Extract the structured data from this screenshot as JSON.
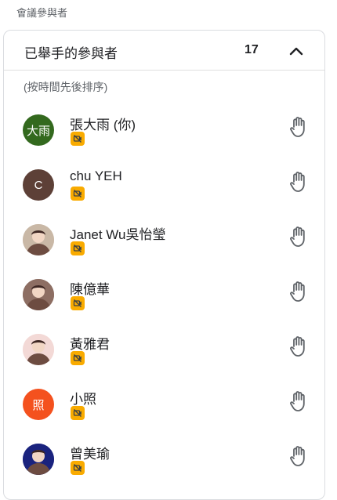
{
  "section_title": "會議參與者",
  "panel": {
    "title": "已舉手的參與者",
    "count": "17",
    "sort_note": "(按時間先後排序)"
  },
  "participants": [
    {
      "name": "張大雨 (你)",
      "avatar_text": "大雨",
      "avatar_color": "#33691e",
      "avatar_type": "initials"
    },
    {
      "name": "chu YEH",
      "avatar_text": "C",
      "avatar_color": "#5d4037",
      "avatar_type": "initials"
    },
    {
      "name": "Janet Wu吳怡瑩",
      "avatar_text": "",
      "avatar_color": "#c9b8a6",
      "avatar_type": "photo"
    },
    {
      "name": "陳億華",
      "avatar_text": "",
      "avatar_color": "#8d6e63",
      "avatar_type": "photo"
    },
    {
      "name": "黃雅君",
      "avatar_text": "",
      "avatar_color": "#f3d9d6",
      "avatar_type": "photo"
    },
    {
      "name": "小照",
      "avatar_text": "照",
      "avatar_color": "#f4511e",
      "avatar_type": "initials"
    },
    {
      "name": "曾美瑜",
      "avatar_text": "",
      "avatar_color": "#1a237e",
      "avatar_type": "photo"
    }
  ],
  "icons": {
    "collapse": "chevron-up-icon",
    "raised_hand": "hand-icon",
    "status_badge": "camera-off-icon"
  },
  "colors": {
    "badge": "#f9ab00",
    "icon": "#5f6368"
  }
}
